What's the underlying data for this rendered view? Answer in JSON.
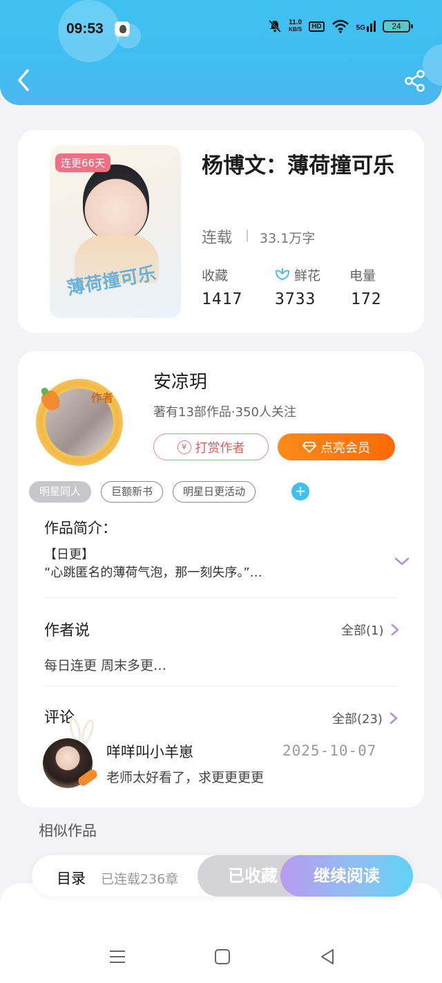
{
  "status_bar": {
    "time": "09:53",
    "speed_value": "11.0",
    "speed_unit": "KB/S",
    "hd": "HD",
    "network": "5G",
    "battery": "24"
  },
  "book": {
    "cover_badge": "连更66天",
    "cover_script": "薄荷撞可乐",
    "title": "杨博文：薄荷撞可乐",
    "status": "连载",
    "word_count": "33.1万字",
    "stats": [
      {
        "label": "收藏",
        "value": "1417"
      },
      {
        "label": "鲜花",
        "value": "3733"
      },
      {
        "label": "电量",
        "value": "172"
      }
    ]
  },
  "author": {
    "avatar_tag": "作者",
    "name": "安凉玥",
    "meta": "著有13部作品·350人关注",
    "tip_button": "打赏作者",
    "tip_icon": "¥",
    "vip_button": "点亮会员"
  },
  "tags": [
    {
      "label": "明星同人",
      "active": true
    },
    {
      "label": "巨额新书",
      "active": false
    },
    {
      "label": "明星日更活动",
      "active": false
    }
  ],
  "tag_add": "+",
  "intro": {
    "heading": "作品简介：",
    "line1": "【日更】",
    "line2": "“心跳匿名的薄荷气泡，那一刻失序。”…"
  },
  "author_says": {
    "heading": "作者说",
    "more": "全部(1)",
    "text": "每日连更 周末多更…"
  },
  "comments": {
    "heading": "评论",
    "more": "全部(23)",
    "items": [
      {
        "user": "咩咩叫小羊崽",
        "date": "2025-10-07",
        "text": "老师太好看了，求更更更更"
      }
    ]
  },
  "similar": {
    "heading": "相似作品"
  },
  "action_bar": {
    "toc": "目录",
    "chapters": "已连载236章",
    "favorite": "已收藏",
    "read": "继续阅读"
  },
  "colors": {
    "header": "#42bdf1",
    "accent_orange": "#fb6a06",
    "accent_blue": "#40c0ef",
    "chevron_purple": "#b48fe0"
  }
}
